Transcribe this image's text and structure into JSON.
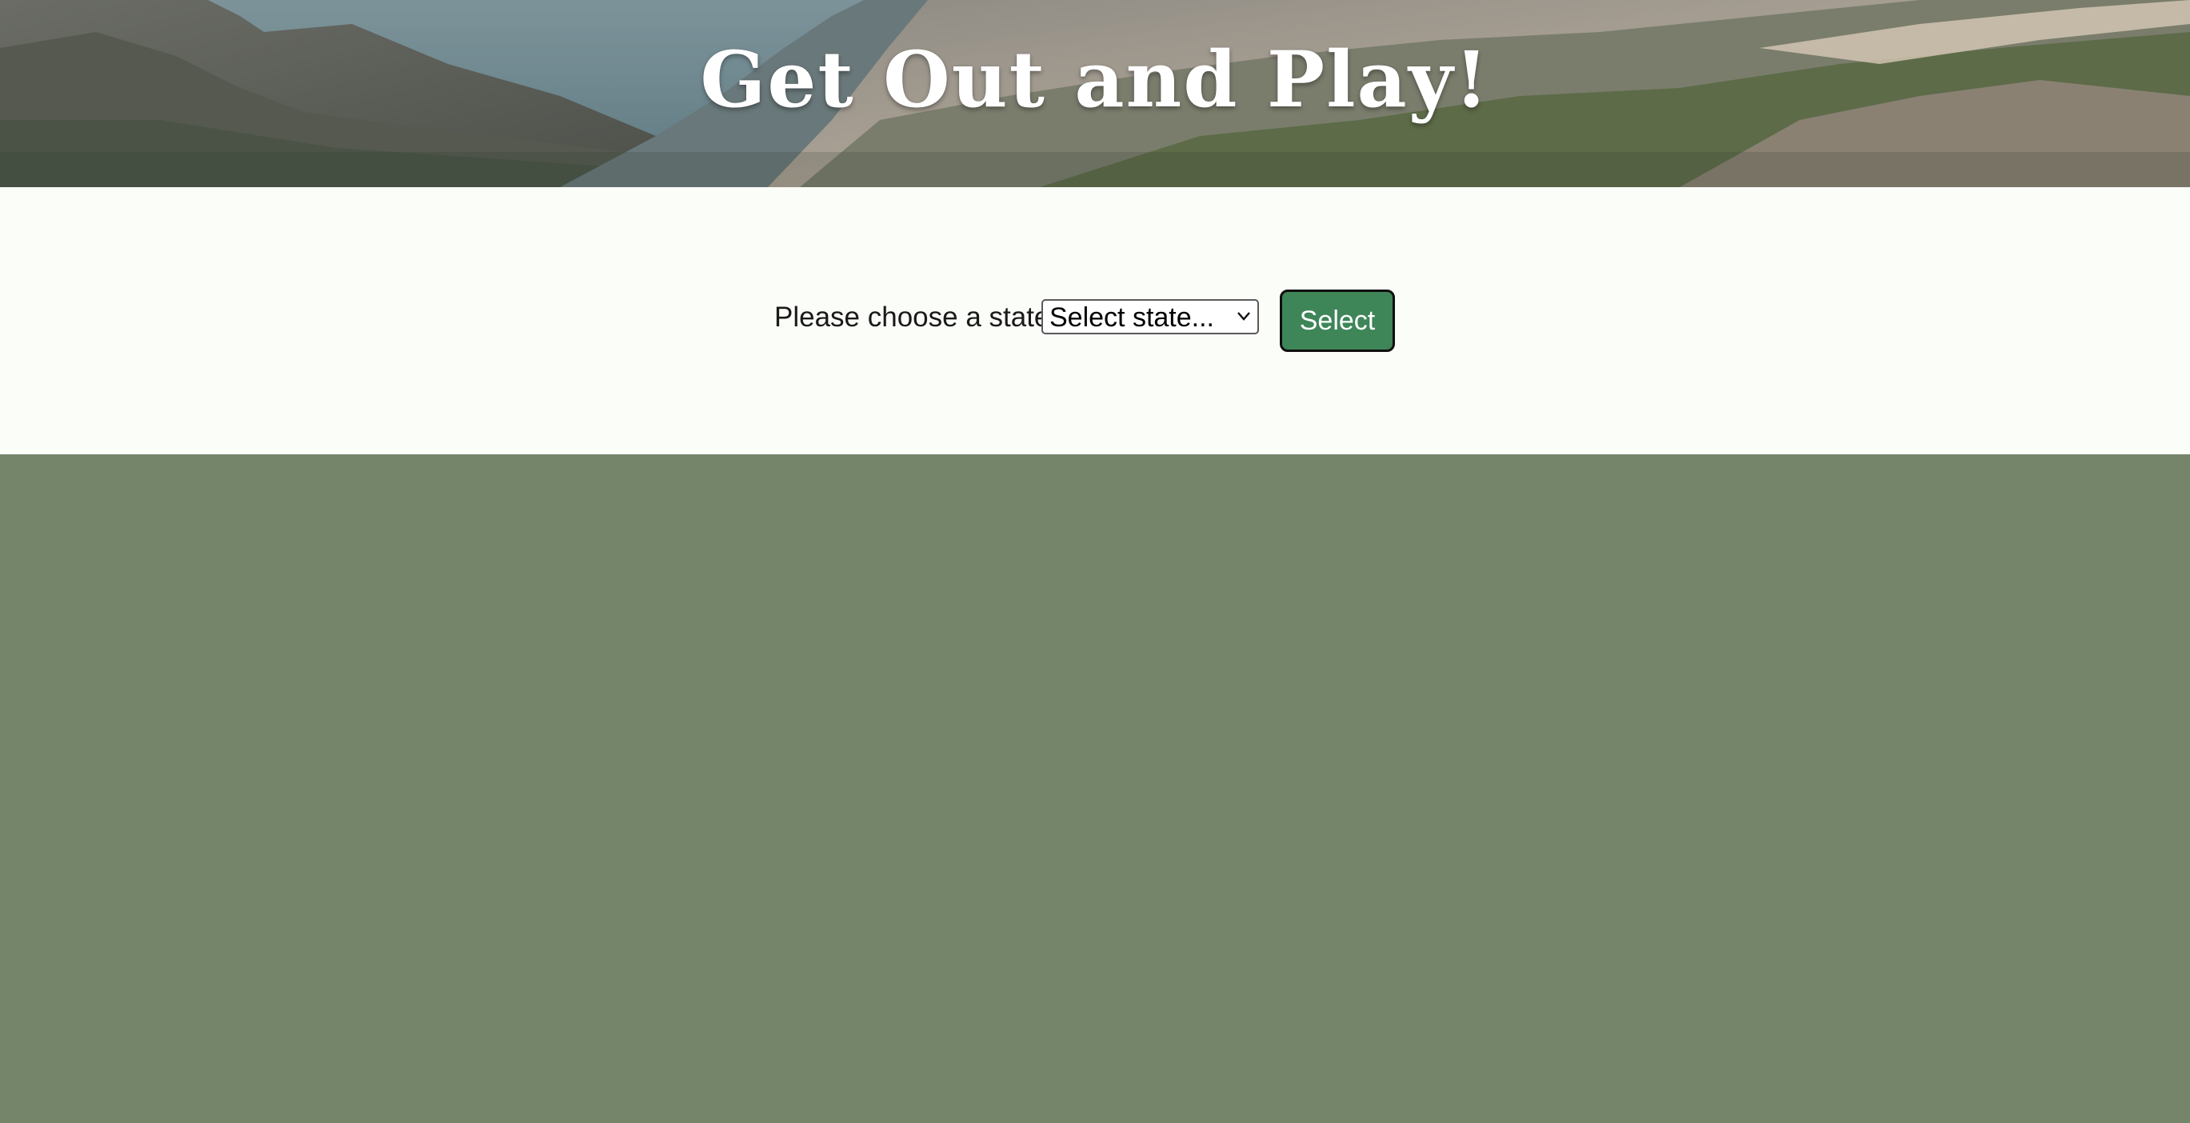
{
  "hero": {
    "title": "Get Out and Play!",
    "image_icon": "mountain-landscape-icon"
  },
  "picker": {
    "label": "Please choose a state:",
    "select_value": "Select state...",
    "select_icon": "chevron-down-icon",
    "button_label": "Select"
  },
  "colors": {
    "band_background": "#fbfdf8",
    "page_background": "#75856a",
    "button_background": "#3e8558",
    "button_text": "#ffffff"
  }
}
